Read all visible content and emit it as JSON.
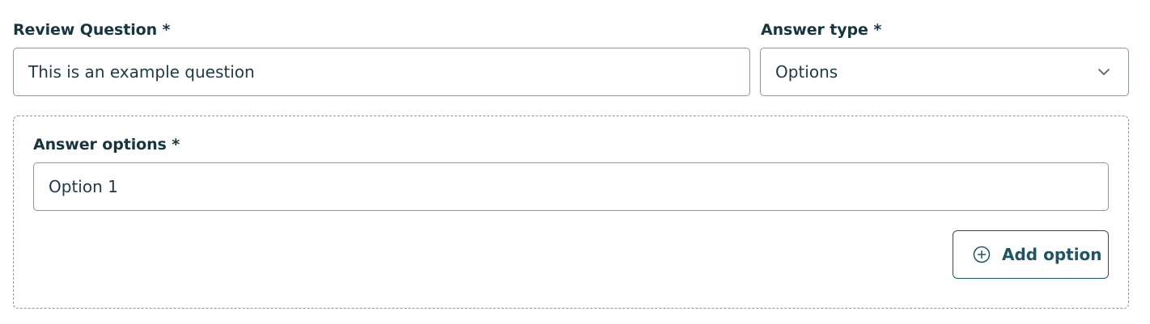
{
  "review_question": {
    "label": "Review Question *",
    "value": "This is an example question"
  },
  "answer_type": {
    "label": "Answer type *",
    "selected": "Options",
    "icon": "chevron-down-icon"
  },
  "answer_options": {
    "label": "Answer options *",
    "items": [
      {
        "value": "Option 1"
      }
    ],
    "add_button": {
      "label": "Add option",
      "icon": "plus-circle-icon"
    }
  },
  "colors": {
    "text": "#17343f",
    "accent": "#1e5566",
    "border": "#8a979d"
  }
}
